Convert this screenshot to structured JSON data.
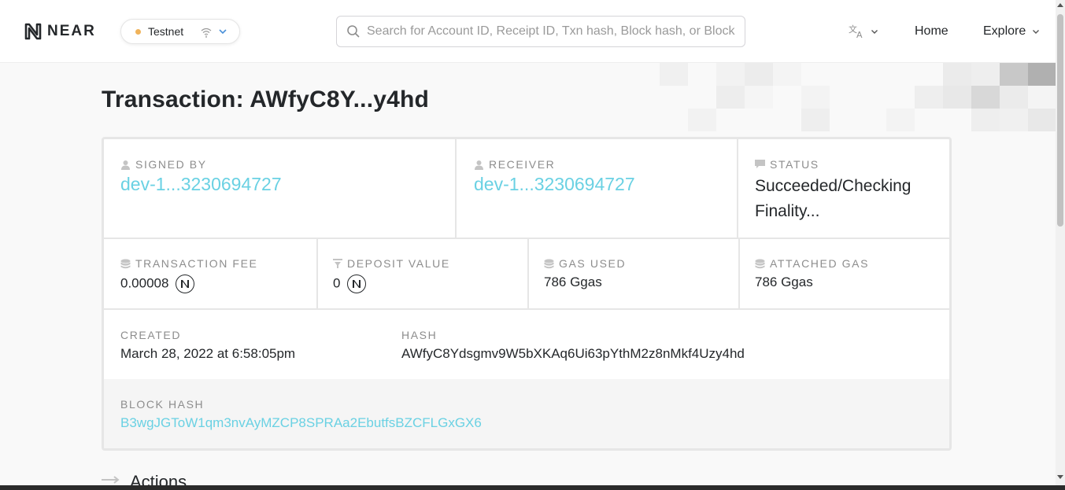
{
  "header": {
    "logo_text": "NEAR",
    "network": {
      "label": "Testnet",
      "dot_color": "#f0b35a"
    },
    "search": {
      "placeholder": "Search for Account ID, Receipt ID, Txn hash, Block hash, or Block"
    },
    "nav": {
      "home_label": "Home",
      "explore_label": "Explore"
    },
    "language_icon": "translate-icon"
  },
  "page": {
    "title": "Transaction: AWfyC8Y...y4hd"
  },
  "transaction": {
    "signed_by": {
      "label": "SIGNED BY",
      "value": "dev-1...3230694727"
    },
    "receiver": {
      "label": "RECEIVER",
      "value": "dev-1...3230694727"
    },
    "status": {
      "label": "STATUS",
      "value": "Succeeded/Checking Finality..."
    },
    "transaction_fee": {
      "label": "TRANSACTION FEE",
      "value": "0.00008"
    },
    "deposit_value": {
      "label": "DEPOSIT VALUE",
      "value": "0"
    },
    "gas_used": {
      "label": "GAS USED",
      "value": "786 Ggas"
    },
    "attached_gas": {
      "label": "ATTACHED GAS",
      "value": "786 Ggas"
    },
    "created": {
      "label": "CREATED",
      "value": "March 28, 2022 at 6:58:05pm"
    },
    "hash": {
      "label": "HASH",
      "value": "AWfyC8Ydsgmv9W5bXKAq6Ui63pYthM2z8nMkf4Uzy4hd"
    },
    "block_hash": {
      "label": "BLOCK HASH",
      "value": "B3wgJGToW1qm3nvAyMZCP8SPRAa2EbutfsBZCFLGxGX6"
    }
  },
  "actions": {
    "title": "Actions"
  },
  "colors": {
    "link": "#6ad1e3",
    "text": "#24272a",
    "label": "#8d8d8d",
    "border": "#e6e6e6"
  }
}
